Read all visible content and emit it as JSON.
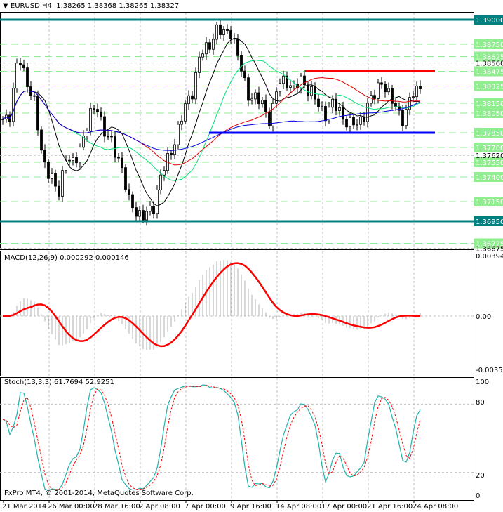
{
  "header": {
    "symbol": "EURUSD,H4",
    "ohlc": "1.38265 1.38368 1.38265 1.38327"
  },
  "macd_label": "MACD(12,26,9) 0.000292 0.000146",
  "stoch_label": "Stoch(13,3,3) 61.7694 52.9251",
  "copyright": "FxPro MT4, © 2001-2014, MetaQuotes Software Corp.",
  "colors": {
    "teal": "#008080",
    "green_level": "#90ee90",
    "support": "#0000ff",
    "resistance": "#ff0000",
    "ma_black": "#000000",
    "ma_green": "#00e07a",
    "ma_red": "#e00000",
    "ma_blue": "#0000e0",
    "stoch_main": "#20b2aa"
  },
  "chart_data": {
    "type": "candlestick",
    "title": "EURUSD,H4",
    "x_tick_labels": [
      "21 Mar 2014",
      "26 Mar 00:00",
      "28 Mar 16:00",
      "2 Apr 08:00",
      "7 Apr 00:00",
      "9 Apr 16:00",
      "14 Apr 08:00",
      "17 Apr 00:00",
      "21 Apr 16:00",
      "24 Apr 08:00"
    ],
    "close_path": [
      1.3799,
      1.3806,
      1.3863,
      1.3841,
      1.3813,
      1.3763,
      1.3741,
      1.372,
      1.3763,
      1.3749,
      1.3777,
      1.3799,
      1.3813,
      1.3784,
      1.377,
      1.3756,
      1.3713,
      1.3706,
      1.3699,
      1.3706,
      1.3741,
      1.3756,
      1.3784,
      1.3806,
      1.3827,
      1.3863,
      1.387,
      1.3891,
      1.3884,
      1.3891,
      1.3856,
      1.3827,
      1.382,
      1.3813,
      1.3799,
      1.3834,
      1.3841,
      1.3827,
      1.3841,
      1.3827,
      1.3813,
      1.3806,
      1.3813,
      1.3806,
      1.3791,
      1.3795,
      1.3806,
      1.382,
      1.3841,
      1.382,
      1.3813,
      1.3795,
      1.3827,
      1.3834
    ],
    "ylim": [
      1.36675,
      1.3921
    ],
    "teal_levels": [
      "1.39000",
      "1.36950"
    ],
    "green_levels": [
      "1.38750",
      "1.38625",
      "1.38475",
      "1.38325",
      "1.38150",
      "1.38050",
      "1.37850",
      "1.37700",
      "1.37550",
      "1.37400",
      "1.37150",
      "1.36725"
    ],
    "plain_levels": [
      "1.38560",
      "1.37620",
      "1.36675"
    ],
    "support_level": 1.3785,
    "resistance_level": 1.38475,
    "macd_axis": [
      "0.003945",
      "0.00",
      "-0.003546"
    ],
    "stoch_axis": [
      "100",
      "80",
      "20",
      "0"
    ]
  }
}
